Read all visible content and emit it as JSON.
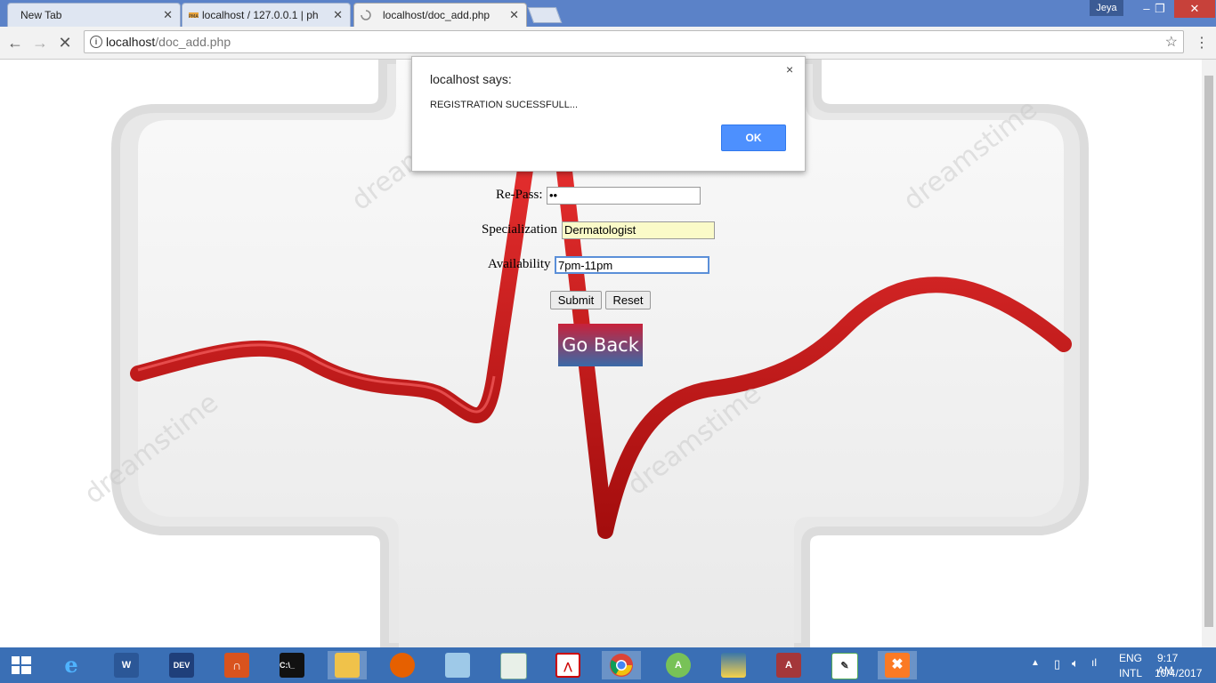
{
  "browser": {
    "tabs": [
      {
        "label": "New Tab",
        "active": false
      },
      {
        "label": "localhost / 127.0.0.1 | php",
        "active": false
      },
      {
        "label": "localhost/doc_add.php",
        "active": true
      }
    ],
    "user_badge": "Jeya",
    "url_host": "localhost",
    "url_path": "/doc_add.php"
  },
  "form": {
    "repass_label": "Re-Pass:",
    "repass_value": "••",
    "specialization_label": "Specialization",
    "specialization_value": "Dermatologist",
    "availability_label": "Availability",
    "availability_value": "7pm-11pm",
    "submit_label": "Submit",
    "reset_label": "Reset",
    "goback_label": "Go Back"
  },
  "dialog": {
    "title": "localhost says:",
    "message": "REGISTRATION SUCESSFULL...",
    "ok_label": "OK",
    "close_glyph": "×"
  },
  "taskbar": {
    "apps": [
      "start-icon",
      "ie-icon",
      "word-icon",
      "devcpp-icon",
      "headphones-icon",
      "cmd-icon",
      "explorer-icon",
      "firefox-icon",
      "notepad-icon",
      "notepad2-icon",
      "acrobat-icon",
      "chrome-icon",
      "android-studio-icon",
      "python-icon",
      "access-icon",
      "editor-icon",
      "xampp-icon"
    ],
    "lang_top": "ENG",
    "lang_bottom": "INTL",
    "time": "9:17 AM",
    "date": "10/4/2017"
  },
  "colors": {
    "titlebar": "#5b82c8",
    "ecg_red": "#d11a1a",
    "taskbar": "#3a6fb5",
    "ok_button": "#4d90fe"
  }
}
